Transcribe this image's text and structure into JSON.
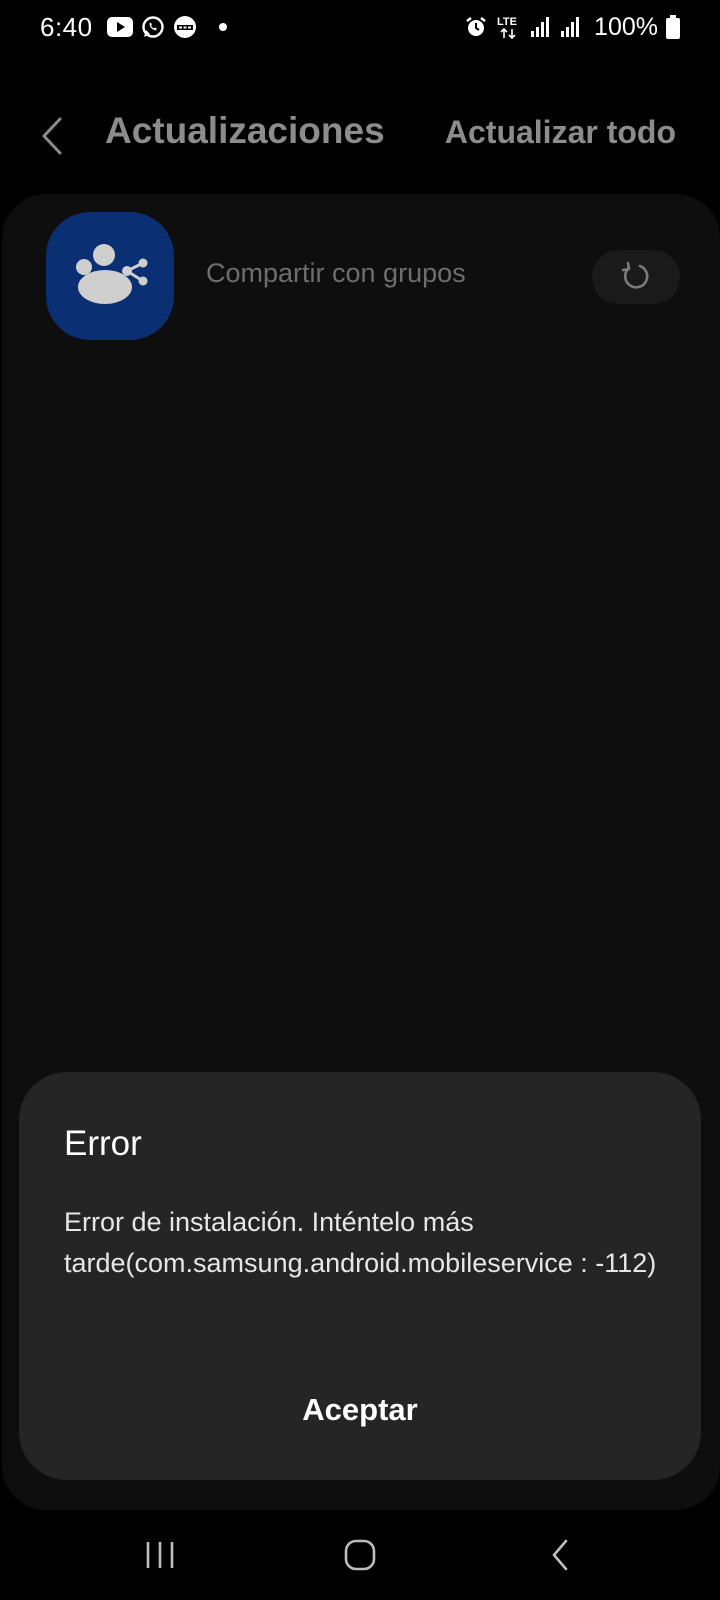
{
  "status_bar": {
    "time": "6:40",
    "battery": "100%",
    "network": "LTE",
    "icons": [
      "youtube-icon",
      "whatsapp-icon",
      "365-icon",
      "notification-dot-icon",
      "alarm-icon",
      "lte-icon",
      "signal-icon",
      "signal-icon",
      "battery-icon"
    ]
  },
  "app_bar": {
    "title": "Actualizaciones",
    "action": "Actualizar todo"
  },
  "updates": [
    {
      "name": "Compartir con grupos",
      "icon": "share-with-groups-icon",
      "action_icon": "retry-icon"
    }
  ],
  "dialog": {
    "title": "Error",
    "message": "Error de instalación. Inténtelo más tarde(com.samsung.android.mobileservice : -112)",
    "button": "Aceptar"
  },
  "nav_bar": {
    "icons": [
      "recent-apps-icon",
      "home-icon",
      "back-icon"
    ]
  },
  "colors": {
    "background": "#000000",
    "card": "#0e0e0e",
    "dialog": "#252525",
    "dim_text": "#8c8c8c",
    "app_icon_bg": "#0b2f73"
  }
}
